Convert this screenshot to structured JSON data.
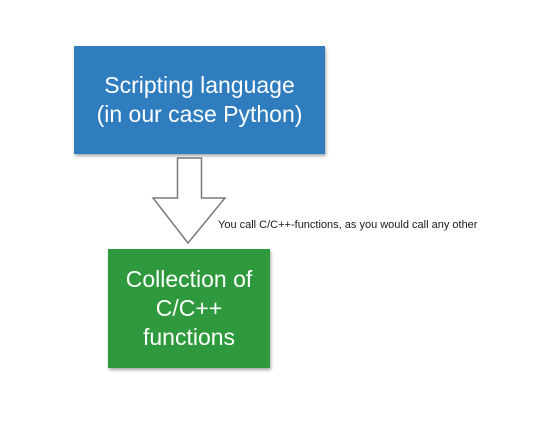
{
  "colors": {
    "top_box": "#2f7dbf",
    "bottom_box": "#2e9a3d",
    "arrow_stroke": "#7a7a7a"
  },
  "top_box": {
    "line1": "Scripting language",
    "line2": "(in our case Python)"
  },
  "bottom_box": {
    "line1": "Collection of",
    "line2": "C/C++",
    "line3": "functions"
  },
  "annotation": "You call C/C++-functions, as you would call any other"
}
